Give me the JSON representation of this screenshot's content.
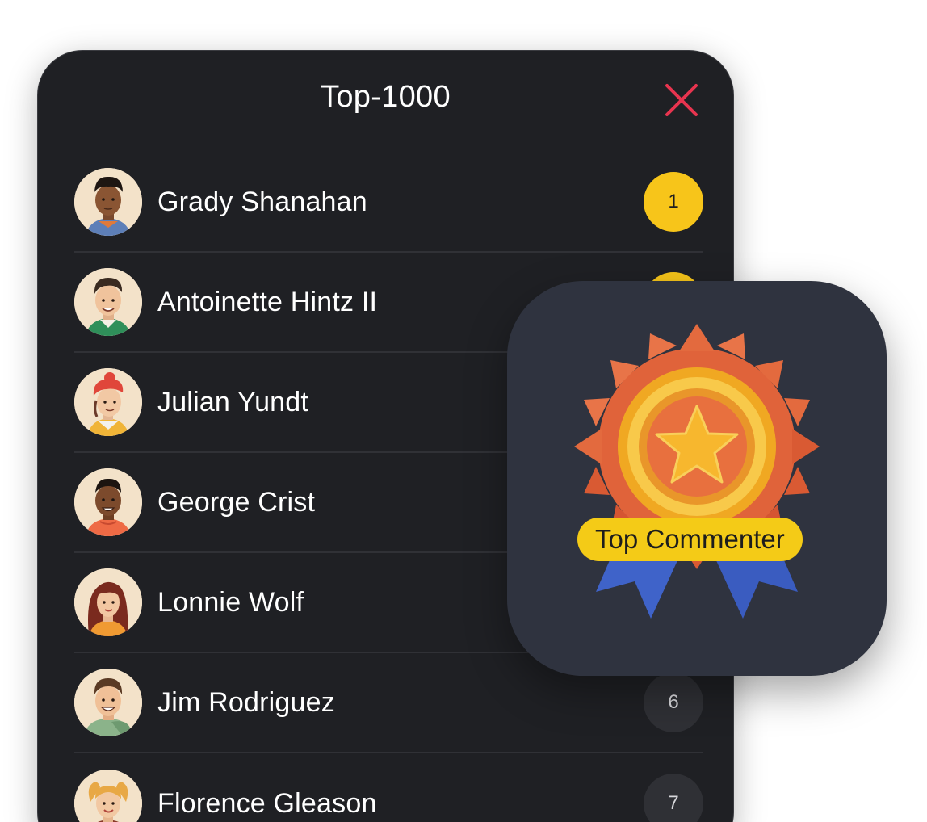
{
  "leaderboard": {
    "title": "Top-1000",
    "rows": [
      {
        "name": "Grady Shanahan",
        "rank": "1",
        "gold": true
      },
      {
        "name": "Antoinette Hintz II",
        "rank": "",
        "gold": true
      },
      {
        "name": "Julian Yundt",
        "rank": "",
        "gold": false
      },
      {
        "name": "George Crist",
        "rank": "",
        "gold": false
      },
      {
        "name": "Lonnie Wolf",
        "rank": "",
        "gold": false
      },
      {
        "name": "Jim Rodriguez",
        "rank": "6",
        "gold": false
      },
      {
        "name": "Florence Gleason",
        "rank": "7",
        "gold": false
      }
    ]
  },
  "badge": {
    "label": "Top Commenter",
    "icon": "medal-icon"
  },
  "colors": {
    "panel_bg": "#1f2024",
    "card_bg": "#2f333f",
    "accent_gold": "#f7c51a",
    "close_red": "#e8344f"
  }
}
